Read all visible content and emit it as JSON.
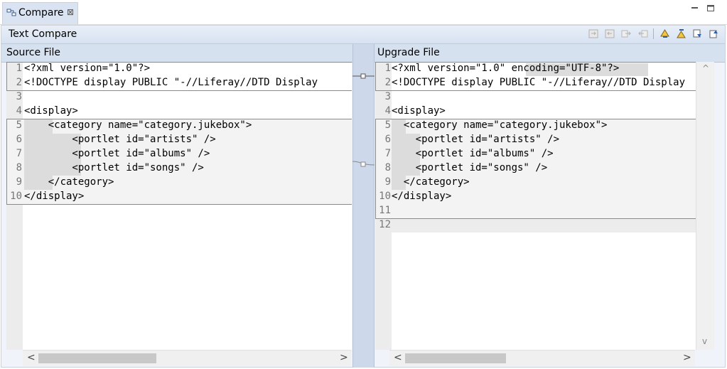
{
  "tab": {
    "label": "Compare",
    "icon": "compare-icon",
    "close_glyph": "⊠"
  },
  "window_controls": {
    "minimize_icon": "minimize-icon",
    "maximize_icon": "maximize-icon"
  },
  "toolbar": {
    "title": "Text Compare",
    "icons": [
      "copy-all-left-to-right-icon",
      "copy-all-right-to-left-icon",
      "copy-current-left-to-right-icon",
      "copy-current-right-to-left-icon",
      "next-difference-icon",
      "previous-difference-icon",
      "next-change-icon",
      "previous-change-icon"
    ]
  },
  "left": {
    "title": "Source File",
    "line_numbers": [
      "1",
      "2",
      "3",
      "4",
      "5",
      "6",
      "7",
      "8",
      "9",
      "10"
    ],
    "lines": [
      "<?xml version=\"1.0\"?>",
      "<!DOCTYPE display PUBLIC \"-//Liferay//DTD Display",
      "",
      "<display>",
      "    <category name=\"category.jukebox\">",
      "        <portlet id=\"artists\" />",
      "        <portlet id=\"albums\" />",
      "        <portlet id=\"songs\" />",
      "    </category>",
      "</display>"
    ]
  },
  "right": {
    "title": "Upgrade File",
    "line_numbers": [
      "1",
      "2",
      "3",
      "4",
      "5",
      "6",
      "7",
      "8",
      "9",
      "10",
      "11",
      "12"
    ],
    "lines": [
      "<?xml version=\"1.0\" encoding=\"UTF-8\"?>",
      "<!DOCTYPE display PUBLIC \"-//Liferay//DTD Display",
      "",
      "<display>",
      "  <category name=\"category.jukebox\">",
      "    <portlet id=\"artists\" />",
      "    <portlet id=\"albums\" />",
      "    <portlet id=\"songs\" />",
      "  </category>",
      "</display>",
      "",
      ""
    ]
  },
  "scroll": {
    "left_arrow": "<",
    "right_arrow": ">",
    "up_arrow": "^",
    "down_arrow": "v"
  }
}
